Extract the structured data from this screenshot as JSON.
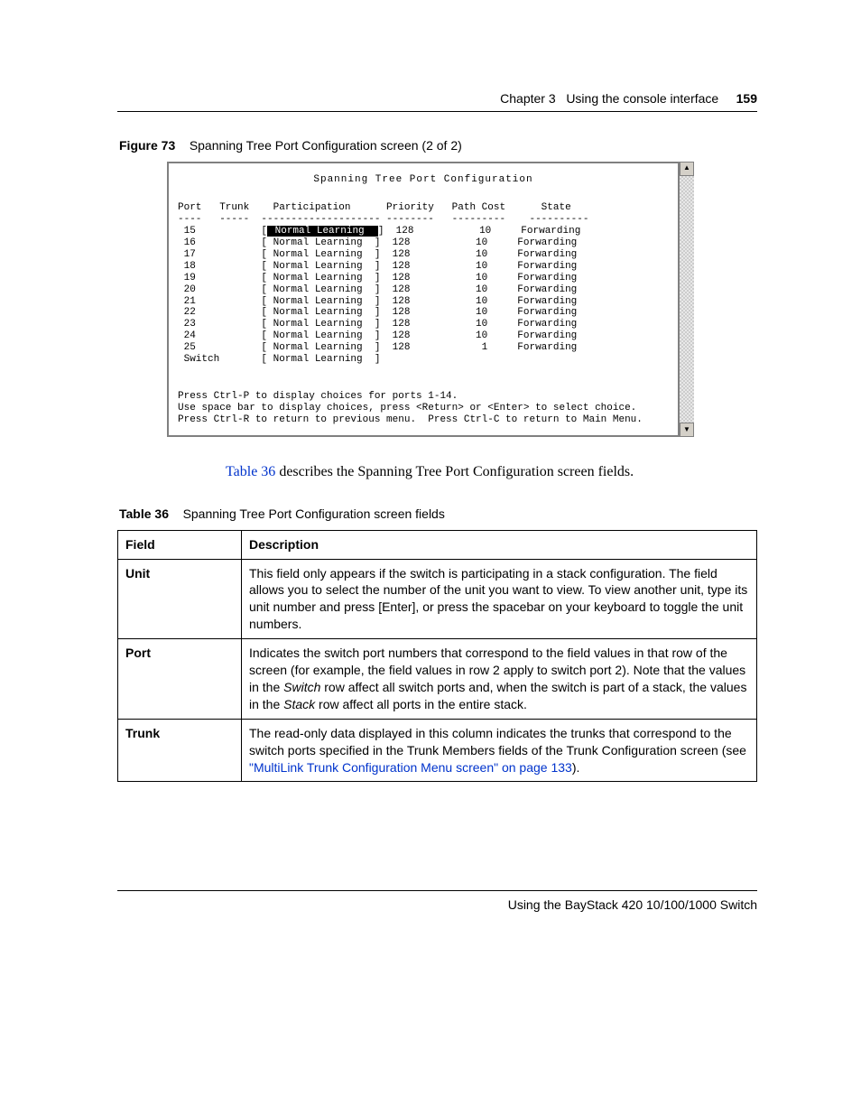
{
  "header": {
    "chapter": "Chapter 3",
    "section": "Using the console interface",
    "page_number": "159"
  },
  "figure": {
    "label": "Figure 73",
    "caption": "Spanning Tree Port Configuration screen (2 of 2)"
  },
  "terminal": {
    "title": "Spanning Tree Port Configuration",
    "columns": {
      "c1": "Port",
      "c2": "Trunk",
      "c3": "Participation",
      "c4": "Priority",
      "c5": "Path Cost",
      "c6": "State"
    },
    "divider": {
      "c1": "----",
      "c2": "-----",
      "c3": "--------------------",
      "c4": "--------",
      "c5": "---------",
      "c6": "----------"
    },
    "rows": [
      {
        "port": "15",
        "trunk": "",
        "participation": "Normal Learning",
        "priority": "128",
        "path_cost": "10",
        "state": "Forwarding",
        "highlighted": true
      },
      {
        "port": "16",
        "trunk": "",
        "participation": "Normal Learning",
        "priority": "128",
        "path_cost": "10",
        "state": "Forwarding",
        "highlighted": false
      },
      {
        "port": "17",
        "trunk": "",
        "participation": "Normal Learning",
        "priority": "128",
        "path_cost": "10",
        "state": "Forwarding",
        "highlighted": false
      },
      {
        "port": "18",
        "trunk": "",
        "participation": "Normal Learning",
        "priority": "128",
        "path_cost": "10",
        "state": "Forwarding",
        "highlighted": false
      },
      {
        "port": "19",
        "trunk": "",
        "participation": "Normal Learning",
        "priority": "128",
        "path_cost": "10",
        "state": "Forwarding",
        "highlighted": false
      },
      {
        "port": "20",
        "trunk": "",
        "participation": "Normal Learning",
        "priority": "128",
        "path_cost": "10",
        "state": "Forwarding",
        "highlighted": false
      },
      {
        "port": "21",
        "trunk": "",
        "participation": "Normal Learning",
        "priority": "128",
        "path_cost": "10",
        "state": "Forwarding",
        "highlighted": false
      },
      {
        "port": "22",
        "trunk": "",
        "participation": "Normal Learning",
        "priority": "128",
        "path_cost": "10",
        "state": "Forwarding",
        "highlighted": false
      },
      {
        "port": "23",
        "trunk": "",
        "participation": "Normal Learning",
        "priority": "128",
        "path_cost": "10",
        "state": "Forwarding",
        "highlighted": false
      },
      {
        "port": "24",
        "trunk": "",
        "participation": "Normal Learning",
        "priority": "128",
        "path_cost": "10",
        "state": "Forwarding",
        "highlighted": false
      },
      {
        "port": "25",
        "trunk": "",
        "participation": "Normal Learning",
        "priority": "128",
        "path_cost": "1",
        "state": "Forwarding",
        "highlighted": false
      }
    ],
    "switch_row": {
      "port": "Switch",
      "participation": "Normal Learning"
    },
    "hints": {
      "l1": "Press Ctrl-P to display choices for ports 1-14.",
      "l2": "Use space bar to display choices, press <Return> or <Enter> to select choice.",
      "l3": "Press Ctrl-R to return to previous menu.  Press Ctrl-C to return to Main Menu."
    }
  },
  "lead": {
    "link": "Table 36",
    "rest": " describes the Spanning Tree Port Configuration screen fields."
  },
  "table": {
    "label": "Table 36",
    "caption": "Spanning Tree Port Configuration screen fields",
    "head": {
      "c1": "Field",
      "c2": "Description"
    },
    "rows": [
      {
        "field": "Unit",
        "desc": "This field only appears if the switch is participating in a stack configuration. The field allows you to select the number of the unit you want to view. To view another unit, type its unit number and press [Enter], or press the spacebar on your keyboard to toggle the unit numbers."
      },
      {
        "field": "Port",
        "desc_pre": "Indicates the switch port numbers that correspond to the field values in that row of the screen (for example, the field values in row 2 apply to switch port 2). Note that the values in the ",
        "desc_em1": "Switch",
        "desc_mid": " row affect all switch ports and, when the switch is part of a stack, the values in the ",
        "desc_em2": "Stack",
        "desc_post": " row affect all ports in the entire stack."
      },
      {
        "field": "Trunk",
        "desc_pre": "The read-only data displayed in this column indicates the trunks that correspond to the switch ports specified in the Trunk Members fields of the Trunk Configuration screen (see ",
        "desc_link": "\"MultiLink Trunk Configuration Menu screen\" on page 133",
        "desc_post": ")."
      }
    ]
  },
  "footer": {
    "text": "Using the BayStack 420 10/100/1000 Switch"
  }
}
